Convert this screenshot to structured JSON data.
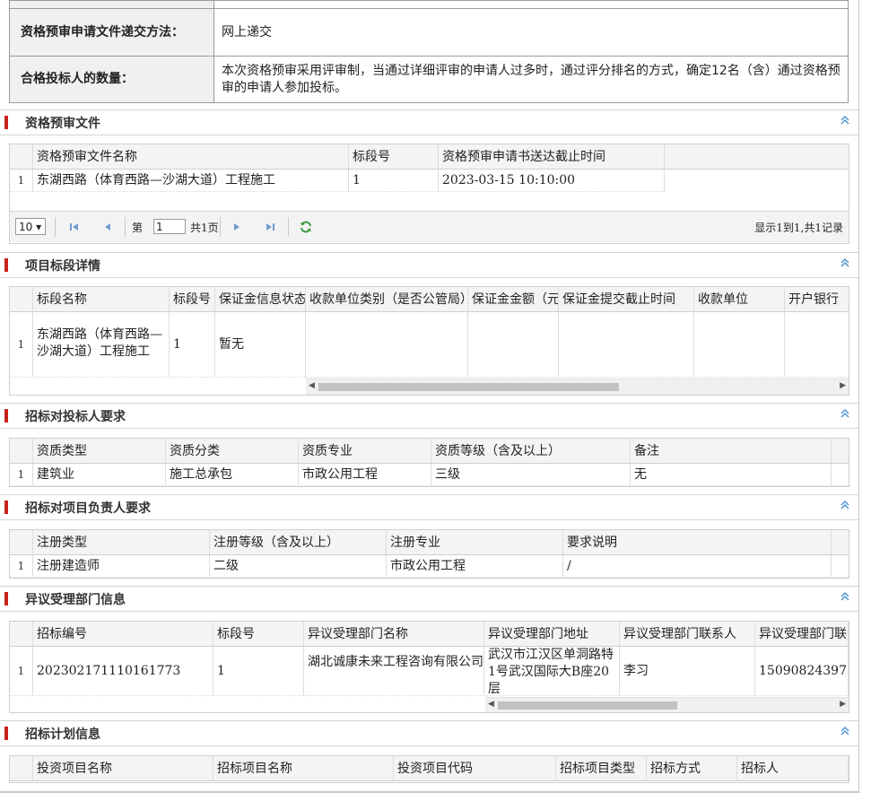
{
  "info": {
    "method_label": "资格预审申请文件递交方法：",
    "method_value": "网上递交",
    "count_label": "合格投标人的数量：",
    "count_value": " 本次资格预审采用评审制，当通过详细评审的申请人过多时，通过评分排名的方式，确定12名（含）通过资格预审的申请人参加投标。"
  },
  "sections": {
    "prequal_docs": "资格预审文件",
    "lot_details": "项目标段详情",
    "bidder_reqs": "招标对投标人要求",
    "manager_reqs": "招标对项目负责人要求",
    "objection": "异议受理部门信息",
    "plan": "招标计划信息"
  },
  "prequal_table": {
    "headers": [
      "资格预审文件名称",
      "标段号",
      "资格预审申请书送达截止时间"
    ],
    "rows": [
      {
        "n": "1",
        "name": "东湖西路（体育西路—沙湖大道）工程施工",
        "lot": "1",
        "deadline": "2023-03-15 10:10:00"
      }
    ]
  },
  "pager": {
    "page_size": "10 ▾",
    "page_prefix": "第",
    "page_value": "1",
    "page_total": "共1页",
    "summary": "显示1到1,共1记录"
  },
  "lot_table": {
    "headers": [
      "标段名称",
      "标段号",
      "保证金信息状态",
      "收款单位类别（是否公管局）",
      "保证金金额（元）",
      "保证金提交截止时间",
      "收款单位",
      "开户银行"
    ],
    "rows": [
      {
        "n": "1",
        "name": "东湖西路（体育西路—沙湖大道）工程施工",
        "lot": "1",
        "status": "暂无"
      }
    ]
  },
  "bidder_table": {
    "headers": [
      "资质类型",
      "资质分类",
      "资质专业",
      "资质等级（含及以上）",
      "备注"
    ],
    "rows": [
      {
        "n": "1",
        "type": "建筑业",
        "category": "施工总承包",
        "major": "市政公用工程",
        "level": "三级",
        "note": "无"
      }
    ]
  },
  "manager_table": {
    "headers": [
      "注册类型",
      "注册等级（含及以上）",
      "注册专业",
      "要求说明"
    ],
    "rows": [
      {
        "n": "1",
        "type": "注册建造师",
        "level": "二级",
        "major": "市政公用工程",
        "desc": "/"
      }
    ]
  },
  "objection_table": {
    "headers": [
      "招标编号",
      "标段号",
      "异议受理部门名称",
      "异议受理部门地址",
      "异议受理部门联系人",
      "异议受理部门联系电话"
    ],
    "rows": [
      {
        "n": "1",
        "code": "202302171110161773",
        "lot": "1",
        "dept": "湖北诚康未来工程咨询有限公司",
        "addr": "武汉市江汉区单洞路特1号武汉国际大B座20层",
        "contact": "李习",
        "phone": "15090824397"
      }
    ]
  },
  "plan_table": {
    "headers": [
      "投资项目名称",
      "招标项目名称",
      "投资项目代码",
      "招标项目类型",
      "招标方式",
      "招标人"
    ]
  },
  "colors": {
    "accent_bar": "#c9221a",
    "header_bg": "#f4f4f4",
    "collapse_icon": "#4a8fd0"
  }
}
